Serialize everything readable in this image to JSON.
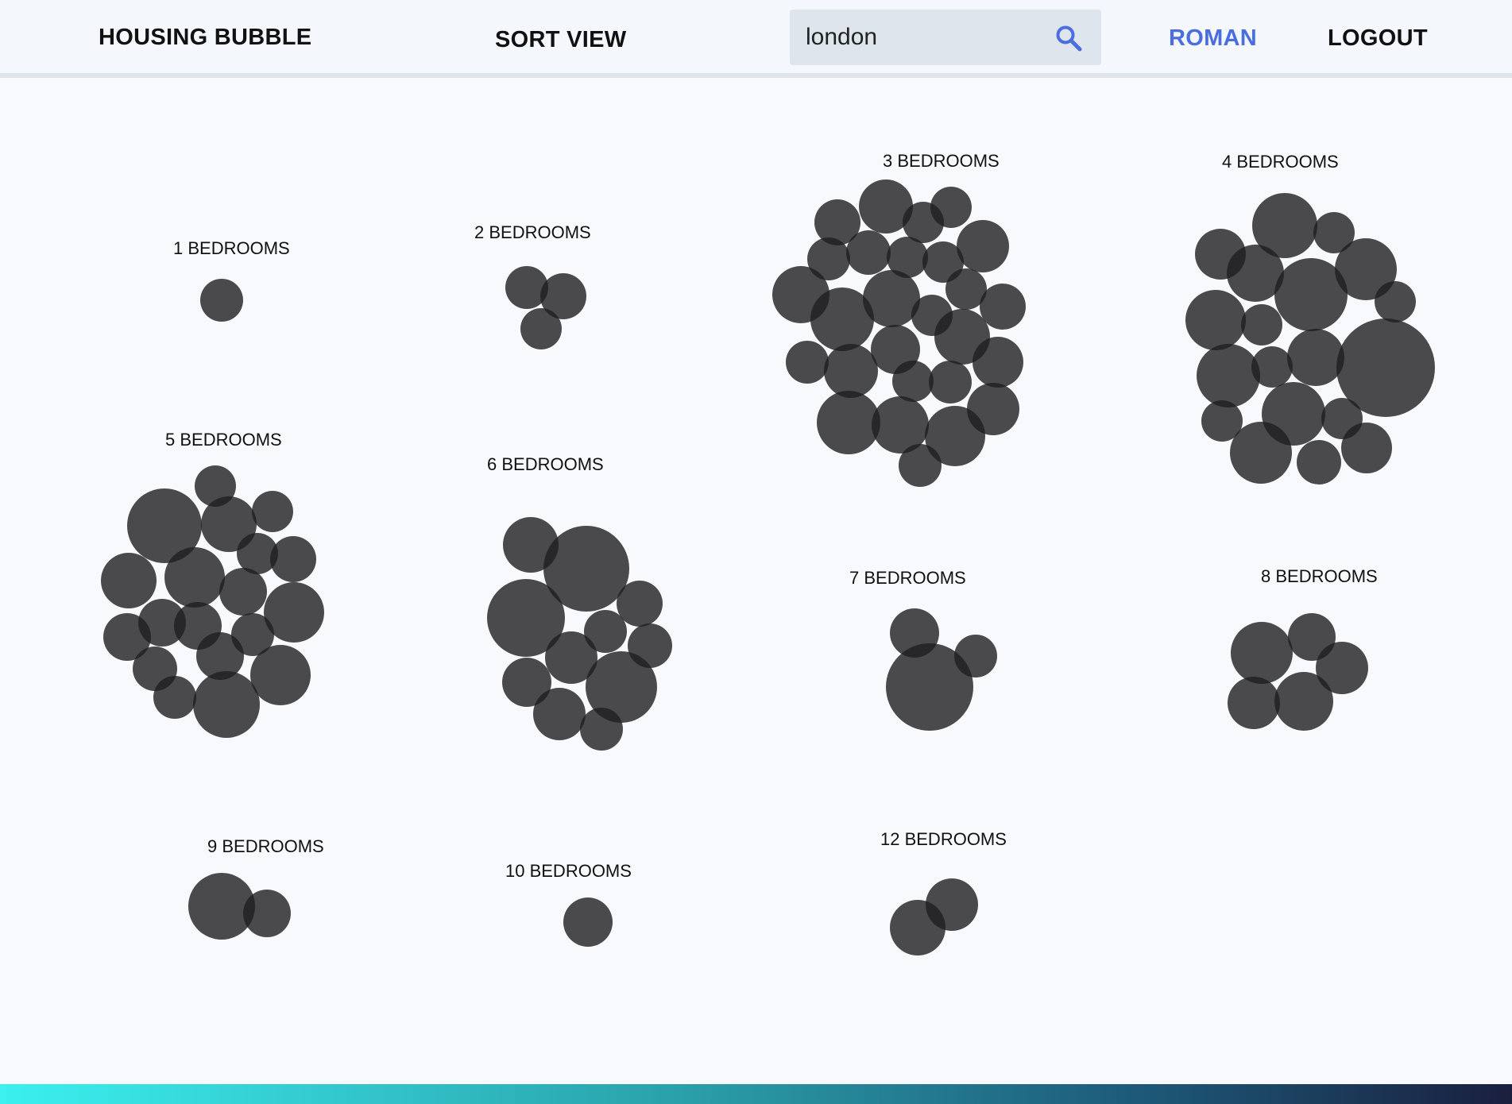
{
  "header": {
    "brand": "HOUSING BUBBLE",
    "sort_view": "SORT VIEW",
    "search": {
      "value": "london",
      "icon": "search-icon"
    },
    "user": "ROMAN",
    "logout": "LOGOUT"
  },
  "colors": {
    "accent": "#4a6ddf",
    "bubble": "#2b2b2d",
    "background": "#f7f9fc",
    "search_bg": "#dfe5ec"
  },
  "groups": [
    {
      "label": "1 BEDROOMS",
      "count": 1
    },
    {
      "label": "2 BEDROOMS",
      "count": 3
    },
    {
      "label": "3 BEDROOMS",
      "count": 29
    },
    {
      "label": "4 BEDROOMS",
      "count": 21
    },
    {
      "label": "5 BEDROOMS",
      "count": 19
    },
    {
      "label": "6 BEDROOMS",
      "count": 12
    },
    {
      "label": "7 BEDROOMS",
      "count": 3
    },
    {
      "label": "8 BEDROOMS",
      "count": 5
    },
    {
      "label": "9 BEDROOMS",
      "count": 2
    },
    {
      "label": "10 BEDROOMS",
      "count": 1
    },
    {
      "label": "12 BEDROOMS",
      "count": 2
    }
  ]
}
